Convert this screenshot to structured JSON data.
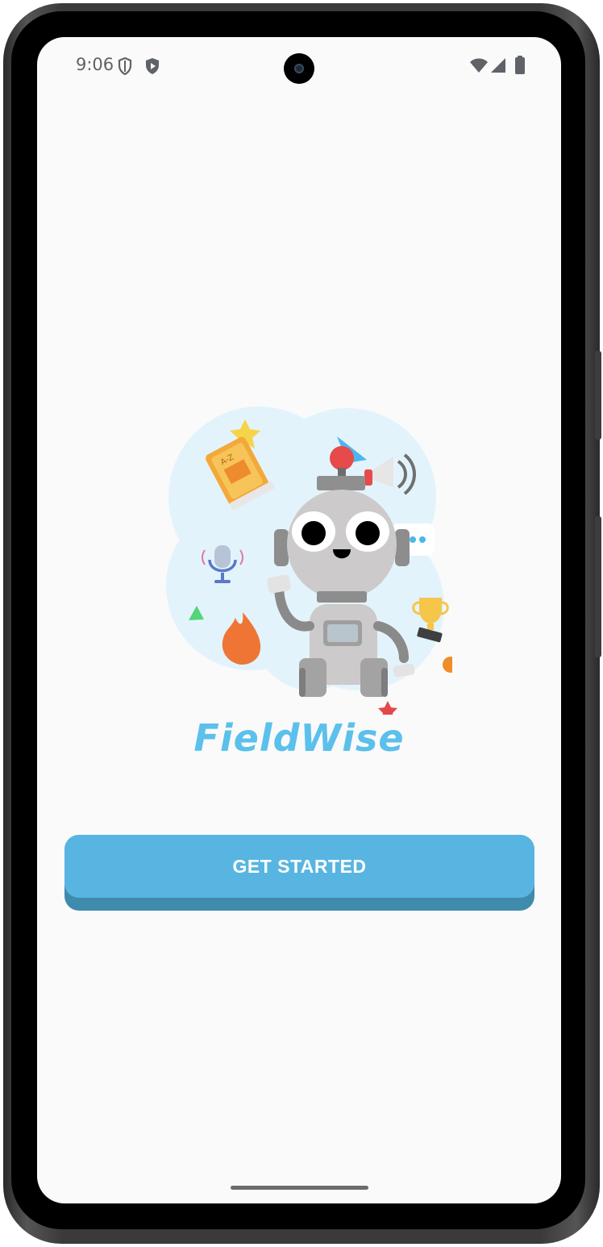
{
  "status_bar": {
    "time": "9:06",
    "left_icons": [
      "shield-icon",
      "play-protect-icon"
    ],
    "right_icons": [
      "wifi-icon",
      "cellular-signal-icon",
      "battery-icon"
    ]
  },
  "illustration": {
    "subject": "robot-mascot",
    "decorations": [
      "star-icon",
      "book-icon",
      "triangle-icon",
      "megaphone-icon",
      "microphone-icon",
      "chat-bubble-icon",
      "trophy-icon",
      "flame-icon"
    ]
  },
  "app": {
    "title": "FieldWise"
  },
  "cta": {
    "label": "GET STARTED"
  },
  "colors": {
    "accent": "#58b5e1",
    "accent_shadow": "#3f8bab",
    "title": "#5bc0eb",
    "background": "#fafafa"
  }
}
